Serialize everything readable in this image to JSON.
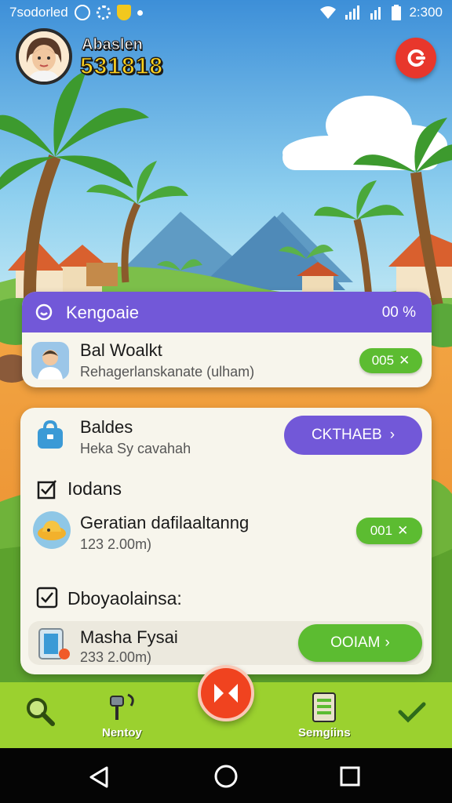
{
  "status_bar": {
    "left_text": "7sodorled",
    "time": "2:300"
  },
  "profile": {
    "name": "Abaslen",
    "score": "531818"
  },
  "card_main": {
    "title": "Kengoaie",
    "percent": "00 %",
    "item": {
      "title": "Bal Woalkt",
      "subtitle": "Rehagerlanskanate (ulham)",
      "button": "005"
    }
  },
  "card_tasks": {
    "top": {
      "title": "Baldes",
      "subtitle": "Heka Sy cavahah",
      "button": "CKTHAEB"
    },
    "section1": {
      "title": "Iodans",
      "item": {
        "title": "Geratian dafilaaltanng",
        "subtitle": "123 2.00m)",
        "button": "001"
      }
    },
    "section2": {
      "title": "Dboyaolainsa:",
      "item": {
        "title": "Masha Fysai",
        "subtitle": "233 2.00m)",
        "button": "OOIAM"
      }
    }
  },
  "bottom_nav": {
    "items": [
      {
        "label": ""
      },
      {
        "label": "Nentoy"
      },
      {
        "label": ""
      },
      {
        "label": "Semgiins"
      },
      {
        "label": ""
      }
    ]
  },
  "colors": {
    "accent_purple": "#7258d8",
    "green": "#5cbc31",
    "nav_green": "#9bd12f",
    "fab_red": "#f0431f"
  }
}
